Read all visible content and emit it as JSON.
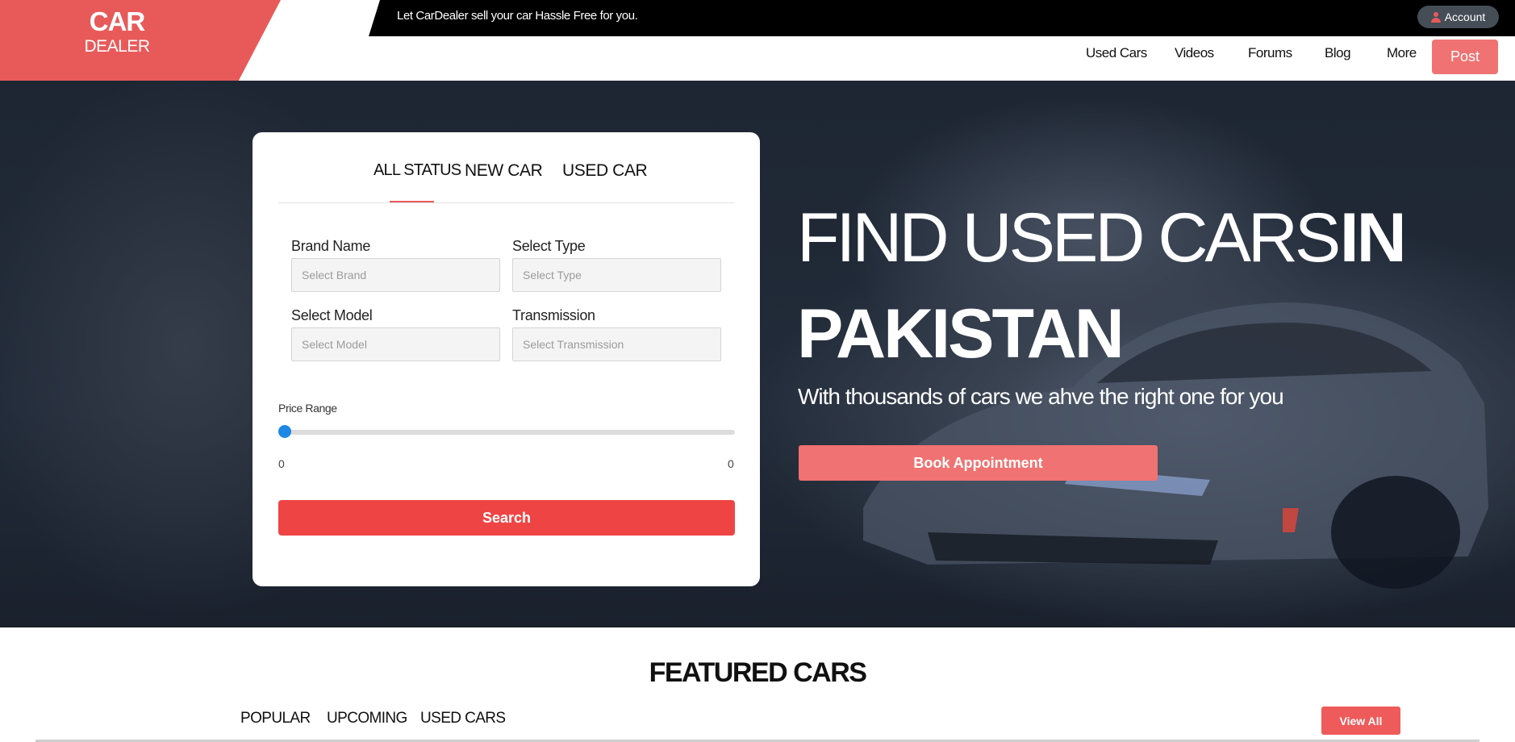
{
  "brand": {
    "line1": "CAR",
    "line2": "DEALER"
  },
  "topbar": {
    "message": "Let CarDealer sell your car Hassle Free for you.",
    "account_label": "Account",
    "account_icon": "user-icon"
  },
  "nav": {
    "items": [
      "Used Cars",
      "Videos",
      "Forums",
      "Blog",
      "More"
    ],
    "post_label": "Post"
  },
  "search": {
    "tabs": [
      "ALL STATUS",
      "NEW CAR",
      "USED CAR"
    ],
    "active_tab": "ALL STATUS",
    "fields": {
      "brand": {
        "label": "Brand Name",
        "placeholder": "Select Brand"
      },
      "type": {
        "label": "Select Type",
        "placeholder": "Select Type"
      },
      "model": {
        "label": "Select Model",
        "placeholder": "Select Model"
      },
      "transmission": {
        "label": "Transmission",
        "placeholder": "Select Transmission"
      }
    },
    "price_range": {
      "label": "Price Range",
      "min": "0",
      "max": "0",
      "value_fraction": 0
    },
    "search_label": "Search"
  },
  "hero": {
    "title_part1": "FIND USED CARS",
    "title_part2": "IN",
    "title_line2": "PAKISTAN",
    "subtitle": "With thousands of cars we ahve the right one for you",
    "cta_label": "Book Appointment"
  },
  "featured": {
    "title": "FEATURED CARS",
    "tabs": [
      "POPULAR",
      "UPCOMING",
      "USED CARS"
    ],
    "view_all_label": "View All"
  },
  "colors": {
    "brand_red": "#e85a5a",
    "button_red": "#ef4444",
    "button_pink": "#f07272",
    "slider_blue": "#1e88e5"
  }
}
